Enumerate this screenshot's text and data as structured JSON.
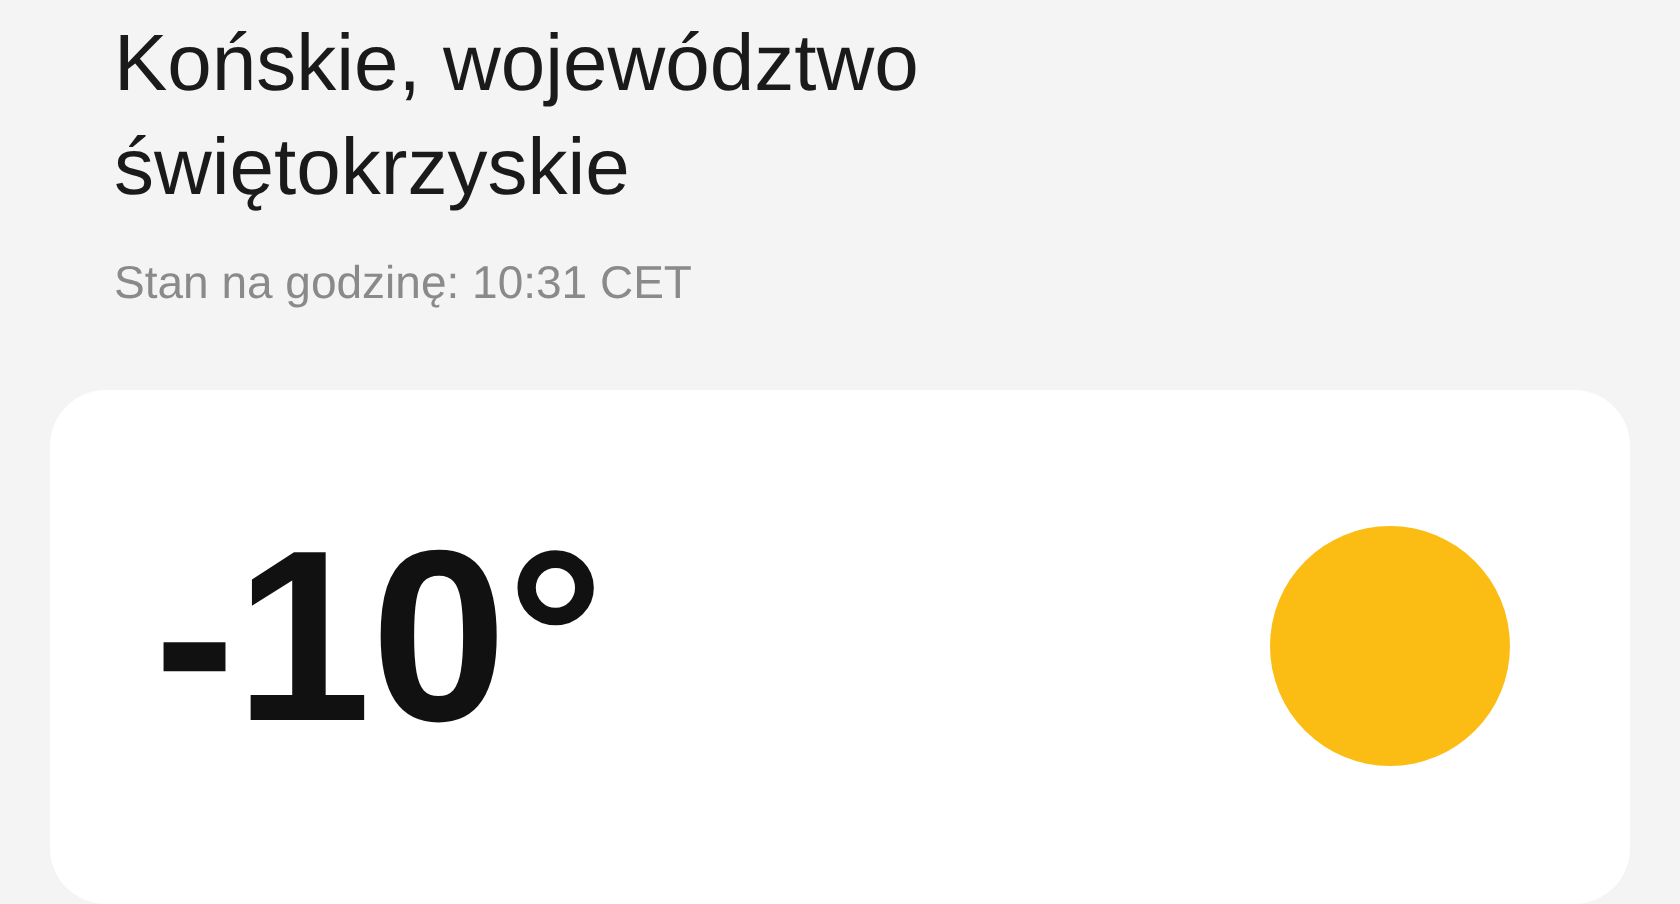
{
  "location": {
    "title": "Końskie, województwo świętokrzyskie"
  },
  "updated": "Stan na godzinę: 10:31 CET",
  "current": {
    "temperature": "-10°"
  }
}
